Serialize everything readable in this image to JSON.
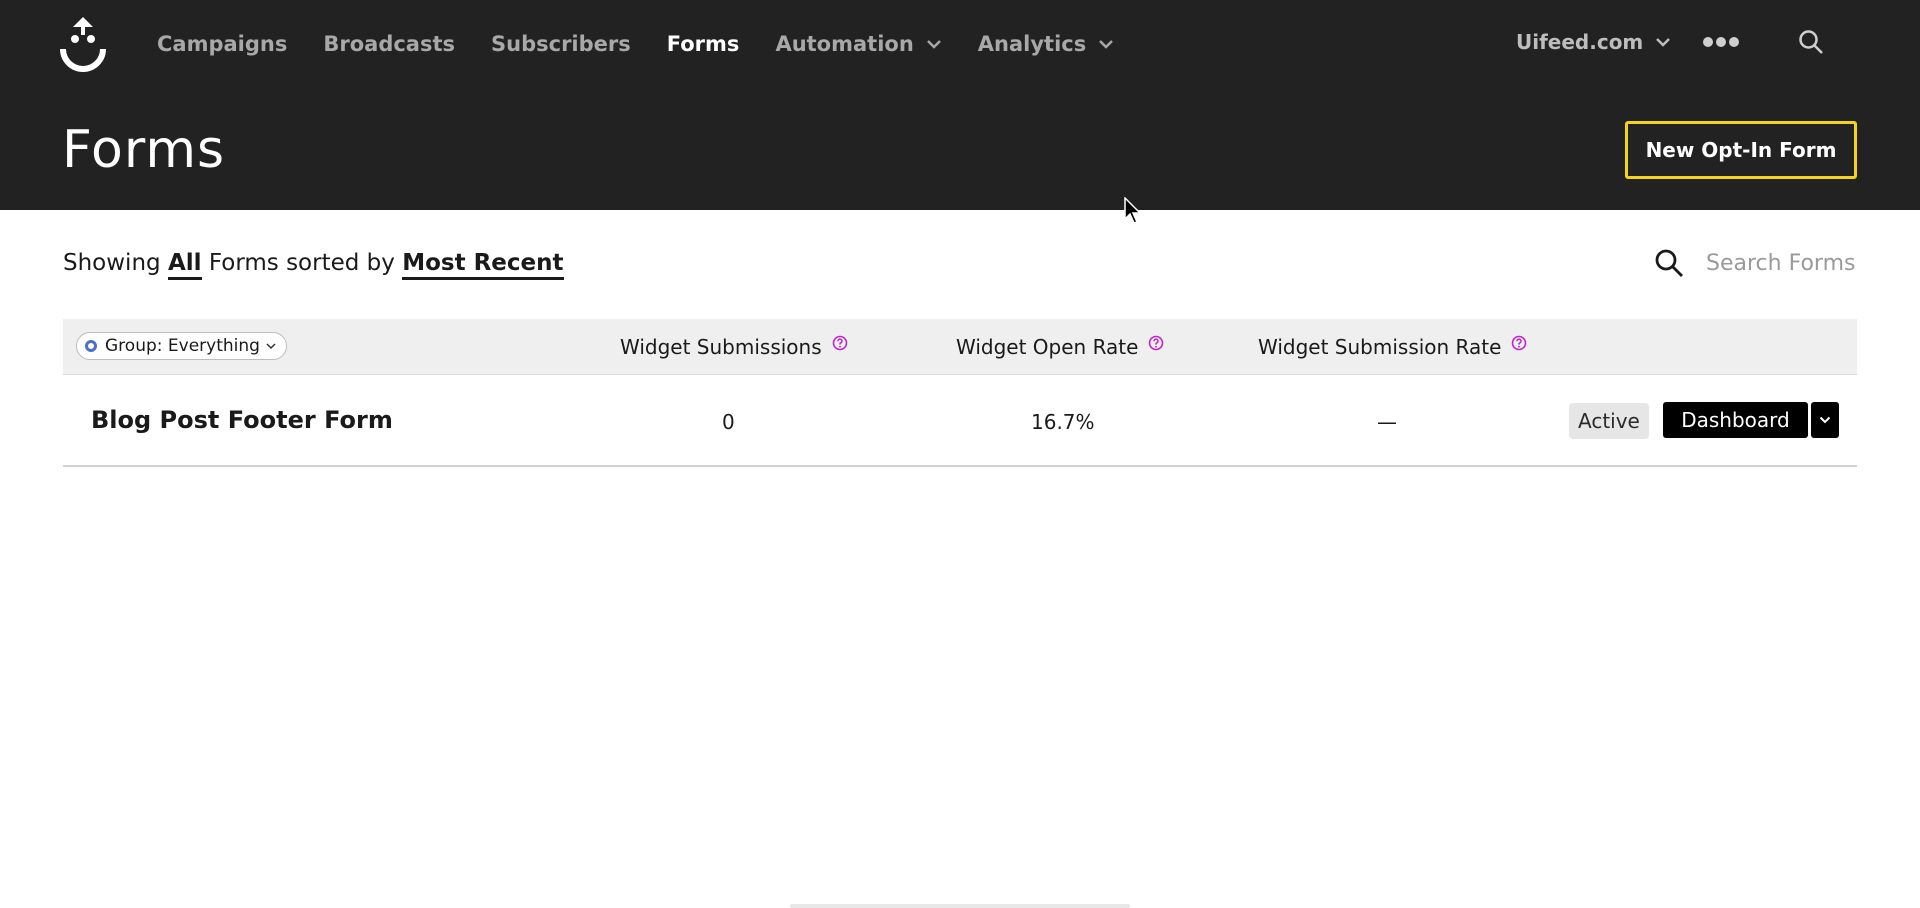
{
  "nav": {
    "items": [
      {
        "label": "Campaigns",
        "active": false,
        "has_menu": false
      },
      {
        "label": "Broadcasts",
        "active": false,
        "has_menu": false
      },
      {
        "label": "Subscribers",
        "active": false,
        "has_menu": false
      },
      {
        "label": "Forms",
        "active": true,
        "has_menu": false
      },
      {
        "label": "Automation",
        "active": false,
        "has_menu": true
      },
      {
        "label": "Analytics",
        "active": false,
        "has_menu": true
      }
    ],
    "account": "Uifeed.com",
    "icons": [
      "logo-icon",
      "more-icon",
      "search-icon",
      "chevron-down-icon"
    ]
  },
  "header": {
    "title": "Forms",
    "new_button": "New Opt-In Form"
  },
  "filter": {
    "prefix": "Showing",
    "scope": "All",
    "middle": "Forms sorted by",
    "sort": "Most Recent"
  },
  "search": {
    "placeholder": "Search Forms"
  },
  "table": {
    "group_filter": "Group: Everything",
    "columns": [
      "Widget Submissions",
      "Widget Open Rate",
      "Widget Submission Rate"
    ],
    "rows": [
      {
        "name": "Blog Post Footer Form",
        "submissions": "0",
        "open_rate": "16.7%",
        "submission_rate": "—",
        "status": "Active",
        "action": "Dashboard"
      }
    ]
  },
  "colors": {
    "header_bg": "#222222",
    "accent_yellow": "#f5d21e",
    "help_icon": "#c026c9",
    "group_dot": "#4a6fd1"
  }
}
